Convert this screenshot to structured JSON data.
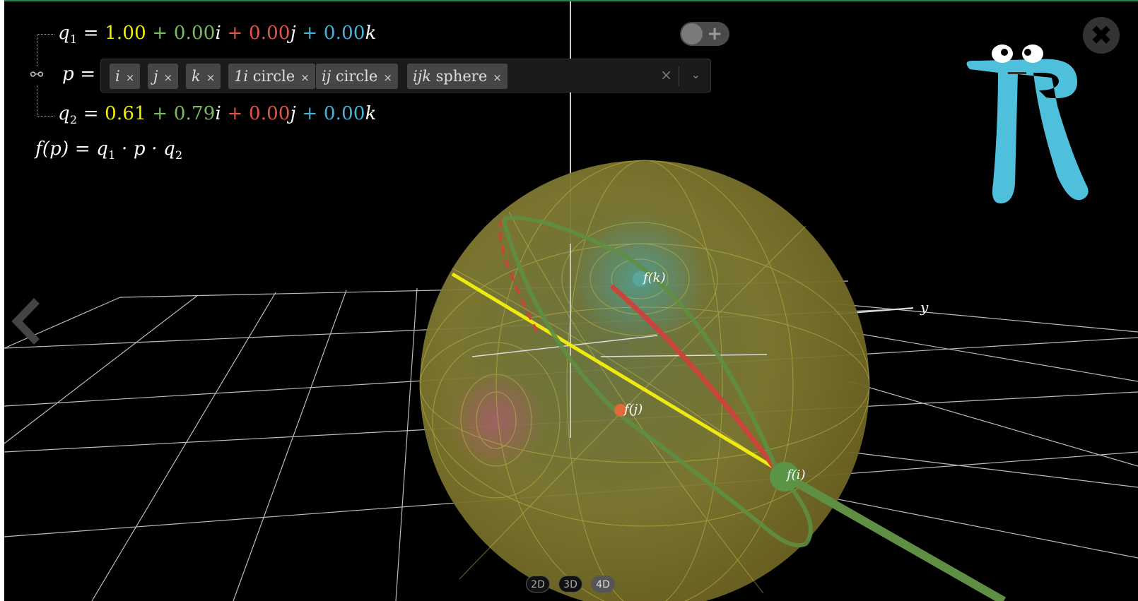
{
  "colors": {
    "real": "#f0f000",
    "i": "#7bbd5a",
    "j": "#e25748",
    "k": "#45b5dc",
    "background": "#000000",
    "mascot": "#4fc0dc"
  },
  "equations": {
    "q1": {
      "name": "q",
      "sub": "1",
      "eq": "=",
      "real": "1.00",
      "op1": "+",
      "i": "0.00",
      "op2": "+",
      "j": "0.00",
      "op3": "+",
      "k": "0.00"
    },
    "p": {
      "name": "p",
      "eq": "="
    },
    "q2": {
      "name": "q",
      "sub": "2",
      "eq": "=",
      "real": "0.61",
      "op1": "+",
      "i": "0.79",
      "op2": "+",
      "j": "0.00",
      "op3": "+",
      "k": "0.00"
    },
    "f": {
      "text": "f(p) = q",
      "sub1": "1",
      "mid": " · p · q",
      "sub2": "2"
    }
  },
  "basis": {
    "i": "i",
    "j": "j",
    "k": "k"
  },
  "selector": {
    "chips": [
      {
        "math": "i",
        "text": "",
        "remove": "×"
      },
      {
        "math": "j",
        "text": "",
        "remove": "×"
      },
      {
        "math": "k",
        "text": "",
        "remove": "×"
      },
      {
        "math": "1i",
        "text": " circle",
        "remove": "×"
      },
      {
        "math": "ij",
        "text": " circle",
        "remove": "×"
      },
      {
        "math": "ijk",
        "text": " sphere",
        "remove": "×"
      }
    ],
    "clear": "×",
    "caret": "⌄"
  },
  "toggle": {
    "plus": "+"
  },
  "close": "✖",
  "points": {
    "fk": "f(k)",
    "fj": "f(j)",
    "fi": "f(i)"
  },
  "axis": {
    "y": "y"
  },
  "view_modes": {
    "d2": "2D",
    "d3": "3D",
    "d4": "4D",
    "active": "4D"
  },
  "icons": {
    "link": "unlink-icon",
    "back": "chevron-left-icon",
    "close": "close-icon",
    "toggle": "toggle-switch",
    "mascot": "pi-mascot-logo"
  }
}
